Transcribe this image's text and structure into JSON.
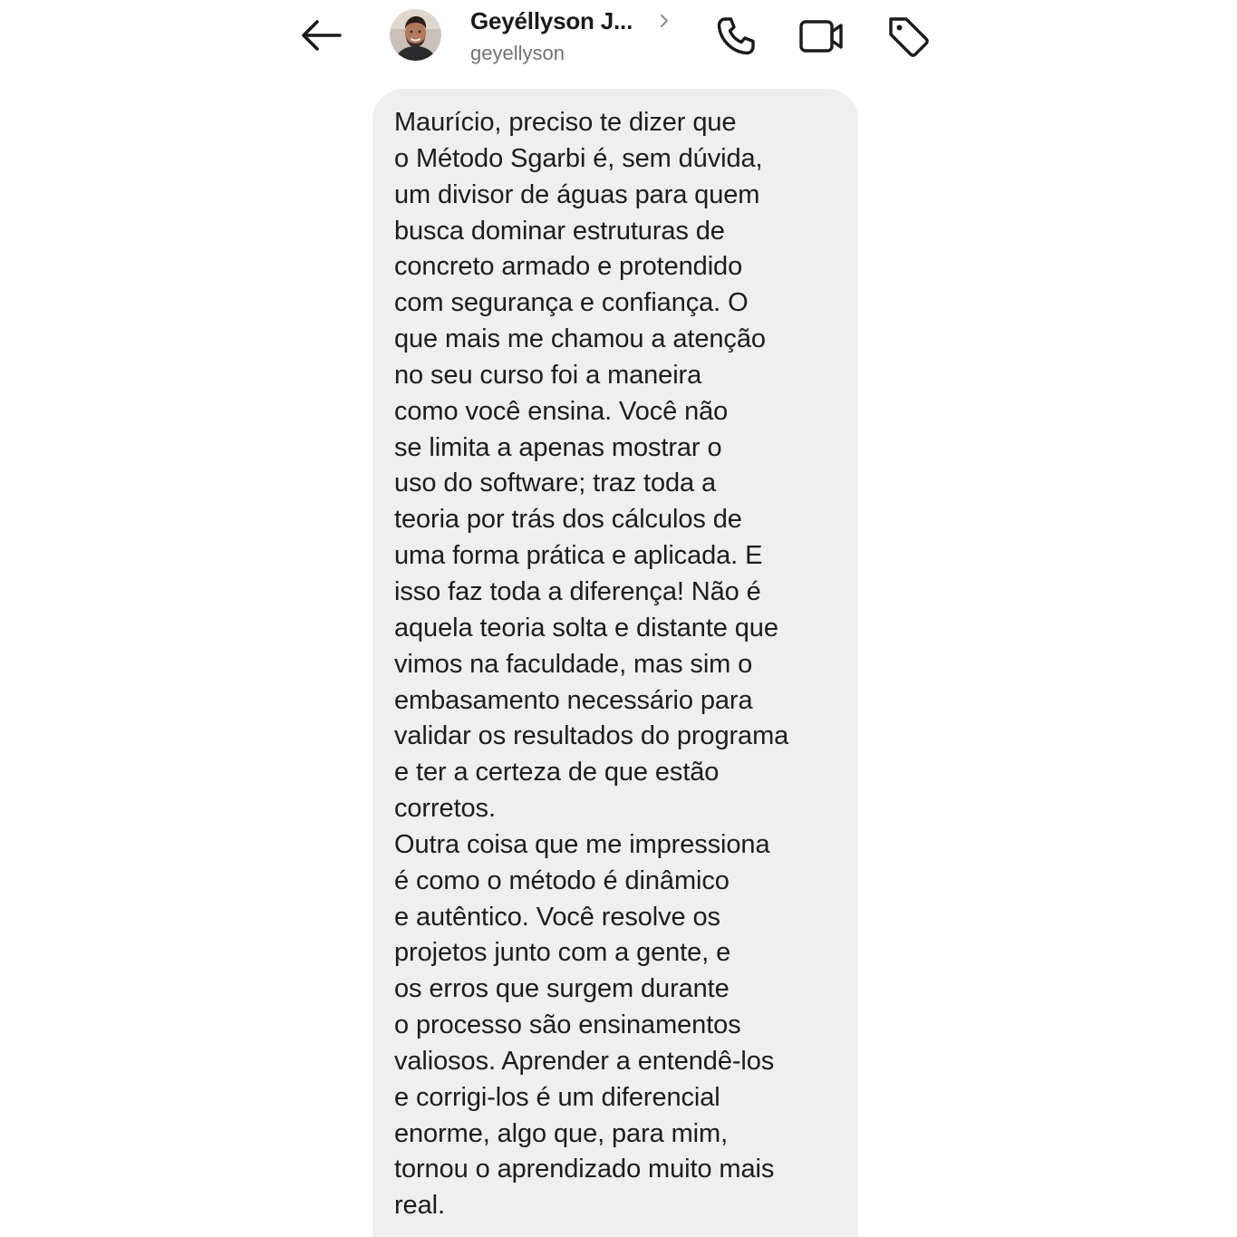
{
  "header": {
    "back_icon": "arrow-left-icon",
    "contact_name": "Geyéllyson J...",
    "contact_handle": "geyellyson",
    "avatar_icon": "profile-photo",
    "chevron_icon": "chevron-right-icon",
    "actions": {
      "call_icon": "phone-icon",
      "video_icon": "video-camera-icon",
      "tag_icon": "tag-icon"
    }
  },
  "message": {
    "lines": [
      "Maurício, preciso te dizer que",
      "o Método Sgarbi é, sem dúvida,",
      "um divisor de águas para quem",
      "busca dominar estruturas de",
      "concreto armado e protendido",
      "com segurança e confiança. O",
      "que mais me chamou a atenção",
      "no seu curso foi a maneira",
      "como você ensina. Você não",
      "se limita a apenas mostrar o",
      "uso do software; traz toda a",
      "teoria por trás dos cálculos de",
      "uma forma prática e aplicada. E",
      "isso faz toda a diferença! Não é",
      "aquela teoria solta e distante que",
      "vimos na faculdade, mas sim o",
      "embasamento necessário para",
      "validar os resultados do programa",
      "e ter a certeza de que estão",
      "corretos.",
      "Outra coisa que me impressiona",
      "é como o método é dinâmico",
      "e autêntico. Você resolve os",
      "projetos junto com a gente, e",
      "os erros que surgem durante",
      "o processo são ensinamentos",
      "valiosos. Aprender a entendê-los",
      "e corrigi-los é um diferencial",
      "enorme, algo que, para mim,",
      "tornou o aprendizado muito mais",
      "real."
    ]
  },
  "colors": {
    "background": "#ffffff",
    "bubble": "#efefef",
    "text": "#1c1c1c",
    "secondary_text": "#737373",
    "icon": "#1a1a1a"
  }
}
